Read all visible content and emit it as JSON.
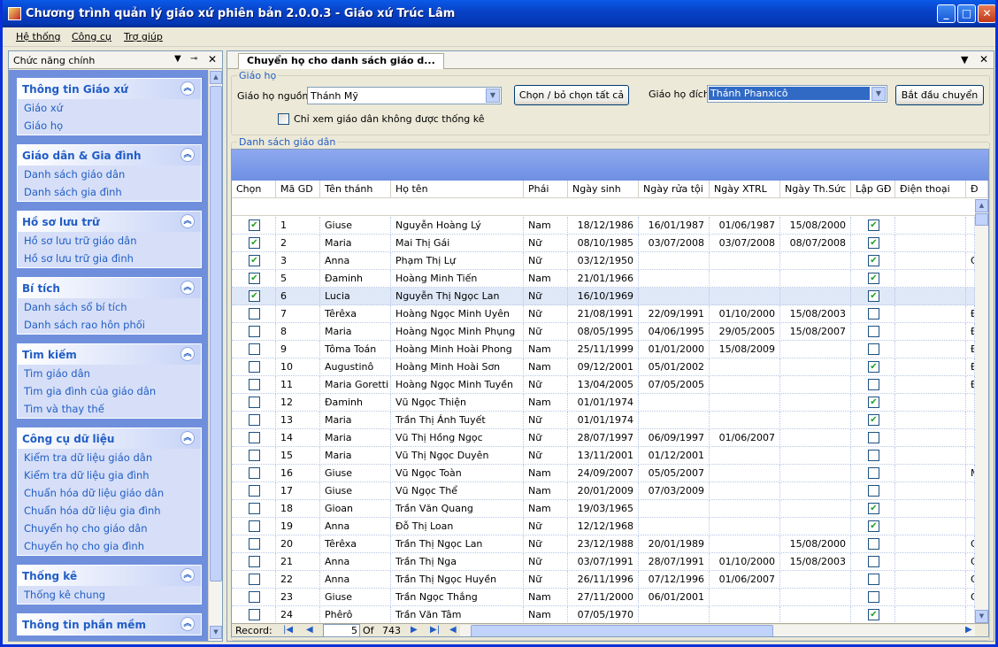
{
  "window": {
    "title": "Chương trình quản lý giáo xứ phiên bản 2.0.0.3 - Giáo xứ Trúc Lâm"
  },
  "menu": [
    "Hệ thống",
    "Công cụ",
    "Trợ giúp"
  ],
  "sidebar": {
    "title": "Chức năng chính",
    "groups": [
      {
        "title": "Thông tin Giáo xứ",
        "items": [
          "Giáo xứ",
          "Giáo họ"
        ]
      },
      {
        "title": "Giáo dân & Gia đình",
        "items": [
          "Danh sách giáo dân",
          "Danh sách gia đình"
        ]
      },
      {
        "title": "Hồ sơ lưu trữ",
        "items": [
          "Hồ sơ lưu trữ giáo dân",
          "Hồ sơ lưu trữ gia đình"
        ]
      },
      {
        "title": "Bí tích",
        "items": [
          "Danh sách sổ bí tích",
          "Danh sách rao hôn phối"
        ]
      },
      {
        "title": "Tìm kiếm",
        "items": [
          "Tìm giáo dân",
          "Tìm gia đình của giáo dân",
          "Tìm và thay thế"
        ]
      },
      {
        "title": "Công cụ dữ liệu",
        "items": [
          "Kiểm tra dữ liệu giáo dân",
          "Kiểm tra dữ liệu gia đình",
          "Chuẩn hóa dữ liệu giáo dân",
          "Chuẩn hóa dữ liệu gia đình",
          "Chuyển họ cho giáo dân",
          "Chuyển họ cho gia đình"
        ]
      },
      {
        "title": "Thống kê",
        "items": [
          "Thống kê chung"
        ]
      },
      {
        "title": "Thông tin phần mềm",
        "items": []
      }
    ]
  },
  "tab": {
    "title": "Chuyển họ cho danh sách giáo d..."
  },
  "form": {
    "group_legend": "Giáo họ",
    "source_label": "Giáo họ nguồn",
    "source_value": "Thánh Mỹ",
    "toggle_all_button": "Chọn / bỏ chọn tất cả",
    "dest_label": "Giáo họ đích",
    "dest_value": "Thánh Phanxicô",
    "start_button": "Bắt đầu chuyển",
    "filter_checkbox": "Chỉ xem giáo dân không được thống kê",
    "list_legend": "Danh sách giáo dân"
  },
  "grid": {
    "columns": [
      "Chọn",
      "Mã GD",
      "Tên thánh",
      "Họ tên",
      "Phái",
      "Ngày sinh",
      "Ngày rửa tội",
      "Ngày XTRL",
      "Ngày Th.Sức",
      "Lập GĐ",
      "Điện thoại",
      "Đ"
    ],
    "rows": [
      {
        "chon": true,
        "ma": "1",
        "thanh": "Giuse",
        "ten": "Nguyễn Hoàng Lý",
        "phai": "Nam",
        "sinh": "18/12/1986",
        "ruatoi": "16/01/1987",
        "xtrl": "01/06/1987",
        "thsuc": "15/08/2000",
        "lapgd": true,
        "dt": "",
        "dc": ""
      },
      {
        "chon": true,
        "ma": "2",
        "thanh": "Maria",
        "ten": "Mai Thị Gái",
        "phai": "Nữ",
        "sinh": "08/10/1985",
        "ruatoi": "03/07/2008",
        "xtrl": "03/07/2008",
        "thsuc": "08/07/2008",
        "lapgd": true,
        "dt": "",
        "dc": ""
      },
      {
        "chon": true,
        "ma": "3",
        "thanh": "Anna",
        "ten": "Phạm Thị Lự",
        "phai": "Nữ",
        "sinh": "03/12/1950",
        "ruatoi": "",
        "xtrl": "",
        "thsuc": "",
        "lapgd": true,
        "dt": "",
        "dc": "G"
      },
      {
        "chon": true,
        "ma": "5",
        "thanh": "Đaminh",
        "ten": "Hoàng Minh Tiến",
        "phai": "Nam",
        "sinh": "21/01/1966",
        "ruatoi": "",
        "xtrl": "",
        "thsuc": "",
        "lapgd": true,
        "dt": "",
        "dc": ""
      },
      {
        "chon": true,
        "ma": "6",
        "thanh": "Lucia",
        "ten": "Nguyễn Thị Ngọc Lan",
        "phai": "Nữ",
        "sinh": "16/10/1969",
        "ruatoi": "",
        "xtrl": "",
        "thsuc": "",
        "lapgd": true,
        "dt": "",
        "dc": "",
        "selected": true
      },
      {
        "chon": false,
        "ma": "7",
        "thanh": "Têrêxa",
        "ten": "Hoàng Ngọc Minh Uyên",
        "phai": "Nữ",
        "sinh": "21/08/1991",
        "ruatoi": "22/09/1991",
        "xtrl": "01/10/2000",
        "thsuc": "15/08/2003",
        "lapgd": false,
        "dt": "",
        "dc": "Đ"
      },
      {
        "chon": false,
        "ma": "8",
        "thanh": "Maria",
        "ten": "Hoàng Ngọc Minh Phụng",
        "phai": "Nữ",
        "sinh": "08/05/1995",
        "ruatoi": "04/06/1995",
        "xtrl": "29/05/2005",
        "thsuc": "15/08/2007",
        "lapgd": false,
        "dt": "",
        "dc": "Đ"
      },
      {
        "chon": false,
        "ma": "9",
        "thanh": "Tôma Toán",
        "ten": "Hoàng Minh Hoài Phong",
        "phai": "Nam",
        "sinh": "25/11/1999",
        "ruatoi": "01/01/2000",
        "xtrl": "15/08/2009",
        "thsuc": "",
        "lapgd": false,
        "dt": "",
        "dc": "Đ"
      },
      {
        "chon": false,
        "ma": "10",
        "thanh": "Augustinô",
        "ten": "Hoàng Minh Hoài Sơn",
        "phai": "Nam",
        "sinh": "09/12/2001",
        "ruatoi": "05/01/2002",
        "xtrl": "",
        "thsuc": "",
        "lapgd": true,
        "dt": "",
        "dc": "Đ"
      },
      {
        "chon": false,
        "ma": "11",
        "thanh": "Maria Goretti",
        "ten": "Hoàng Ngọc Minh Tuyền",
        "phai": "Nữ",
        "sinh": "13/04/2005",
        "ruatoi": "07/05/2005",
        "xtrl": "",
        "thsuc": "",
        "lapgd": false,
        "dt": "",
        "dc": "Đ"
      },
      {
        "chon": false,
        "ma": "12",
        "thanh": "Đaminh",
        "ten": "Vũ Ngọc Thiện",
        "phai": "Nam",
        "sinh": "01/01/1974",
        "ruatoi": "",
        "xtrl": "",
        "thsuc": "",
        "lapgd": true,
        "dt": "",
        "dc": ""
      },
      {
        "chon": false,
        "ma": "13",
        "thanh": "Maria",
        "ten": "Trần Thị Ánh Tuyết",
        "phai": "Nữ",
        "sinh": "01/01/1974",
        "ruatoi": "",
        "xtrl": "",
        "thsuc": "",
        "lapgd": true,
        "dt": "",
        "dc": ""
      },
      {
        "chon": false,
        "ma": "14",
        "thanh": "Maria",
        "ten": "Vũ Thị Hồng Ngọc",
        "phai": "Nữ",
        "sinh": "28/07/1997",
        "ruatoi": "06/09/1997",
        "xtrl": "01/06/2007",
        "thsuc": "",
        "lapgd": false,
        "dt": "",
        "dc": ""
      },
      {
        "chon": false,
        "ma": "15",
        "thanh": "Maria",
        "ten": "Vũ Thị Ngọc Duyên",
        "phai": "Nữ",
        "sinh": "13/11/2001",
        "ruatoi": "01/12/2001",
        "xtrl": "",
        "thsuc": "",
        "lapgd": false,
        "dt": "",
        "dc": ""
      },
      {
        "chon": false,
        "ma": "16",
        "thanh": "Giuse",
        "ten": "Vũ Ngọc Toàn",
        "phai": "Nam",
        "sinh": "24/09/2007",
        "ruatoi": "05/05/2007",
        "xtrl": "",
        "thsuc": "",
        "lapgd": false,
        "dt": "",
        "dc": "M"
      },
      {
        "chon": false,
        "ma": "17",
        "thanh": "Giuse",
        "ten": "Vũ Ngọc Thể",
        "phai": "Nam",
        "sinh": "20/01/2009",
        "ruatoi": "07/03/2009",
        "xtrl": "",
        "thsuc": "",
        "lapgd": false,
        "dt": "",
        "dc": ""
      },
      {
        "chon": false,
        "ma": "18",
        "thanh": "Gioan",
        "ten": "Trần Văn Quang",
        "phai": "Nam",
        "sinh": "19/03/1965",
        "ruatoi": "",
        "xtrl": "",
        "thsuc": "",
        "lapgd": true,
        "dt": "",
        "dc": ""
      },
      {
        "chon": false,
        "ma": "19",
        "thanh": "Anna",
        "ten": "Đỗ Thị Loan",
        "phai": "Nữ",
        "sinh": "12/12/1968",
        "ruatoi": "",
        "xtrl": "",
        "thsuc": "",
        "lapgd": true,
        "dt": "",
        "dc": ""
      },
      {
        "chon": false,
        "ma": "20",
        "thanh": "Têrêxa",
        "ten": "Trần Thị Ngọc Lan",
        "phai": "Nữ",
        "sinh": "23/12/1988",
        "ruatoi": "20/01/1989",
        "xtrl": "",
        "thsuc": "15/08/2000",
        "lapgd": false,
        "dt": "",
        "dc": "G"
      },
      {
        "chon": false,
        "ma": "21",
        "thanh": "Anna",
        "ten": "Trần Thị Nga",
        "phai": "Nữ",
        "sinh": "03/07/1991",
        "ruatoi": "28/07/1991",
        "xtrl": "01/10/2000",
        "thsuc": "15/08/2003",
        "lapgd": false,
        "dt": "",
        "dc": "G"
      },
      {
        "chon": false,
        "ma": "22",
        "thanh": "Anna",
        "ten": "Trần Thị Ngọc Huyền",
        "phai": "Nữ",
        "sinh": "26/11/1996",
        "ruatoi": "07/12/1996",
        "xtrl": "01/06/2007",
        "thsuc": "",
        "lapgd": false,
        "dt": "",
        "dc": "G"
      },
      {
        "chon": false,
        "ma": "23",
        "thanh": "Giuse",
        "ten": "Trần Ngọc Thắng",
        "phai": "Nam",
        "sinh": "27/11/2000",
        "ruatoi": "06/01/2001",
        "xtrl": "",
        "thsuc": "",
        "lapgd": false,
        "dt": "",
        "dc": "G"
      },
      {
        "chon": false,
        "ma": "24",
        "thanh": "Phêrô",
        "ten": "Trần Văn Tâm",
        "phai": "Nam",
        "sinh": "07/05/1970",
        "ruatoi": "",
        "xtrl": "",
        "thsuc": "",
        "lapgd": true,
        "dt": "",
        "dc": ""
      }
    ]
  },
  "navigator": {
    "record_label": "Record:",
    "current": "5",
    "of_label": "Of",
    "total": "743"
  }
}
